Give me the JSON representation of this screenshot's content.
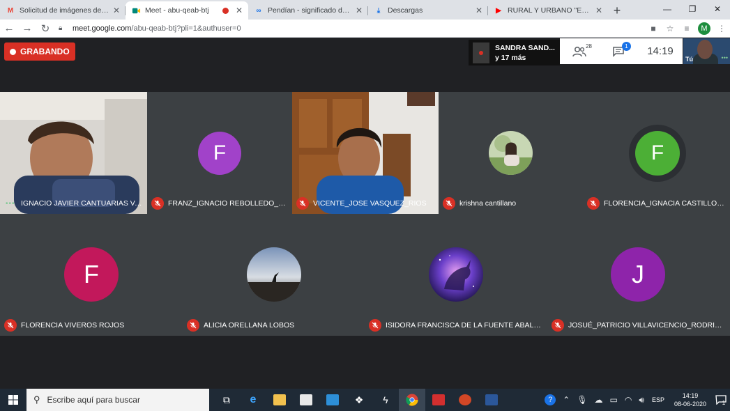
{
  "browser": {
    "tabs": [
      {
        "label": "Solicitud de imágenes de clase",
        "favicon": "M",
        "favicon_color": "#ea4335",
        "active": false,
        "recording": false
      },
      {
        "label": "Meet - abu-qeab-btj",
        "favicon": "▸",
        "favicon_color": "#00897b",
        "active": true,
        "recording": true
      },
      {
        "label": "Pendían - significado de pendí",
        "favicon": "∞",
        "favicon_color": "#1a73e8",
        "active": false,
        "recording": false
      },
      {
        "label": "Descargas",
        "favicon": "⤓",
        "favicon_color": "#1a73e8",
        "active": false,
        "recording": false
      },
      {
        "label": "RURAL Y URBANO \"EL CAMPO",
        "favicon": "▶",
        "favicon_color": "#ff0000",
        "active": false,
        "recording": false
      }
    ],
    "url_host": "meet.google.com",
    "url_path": "/abu-qeab-btj?pli=1&authuser=0",
    "profile_initial": "M"
  },
  "meet": {
    "recording_label": "GRABANDO",
    "presenter_line1": "SANDRA SAND...",
    "presenter_line2": "y 17 más",
    "participants_count": "28",
    "chat_count": "1",
    "clock": "14:19",
    "self_label": "Tú",
    "row1": [
      {
        "name": "IGNACIO JAVIER CANTUARIAS VAL...",
        "kind": "video-boy1",
        "muted": false
      },
      {
        "name": "FRANZ_IGNACIO REBOLLEDO_CAR...",
        "kind": "letter",
        "letter": "F",
        "color": "#a142c9",
        "muted": true
      },
      {
        "name": "VICENTE_JOSE VASQUEZ_RIOS",
        "kind": "video-boy2",
        "muted": true
      },
      {
        "name": "krishna cantillano",
        "kind": "photo-girl",
        "muted": true
      },
      {
        "name": "FLORENCIA_IGNACIA CASTILLO_R...",
        "kind": "letter",
        "letter": "F",
        "color": "#4caf36",
        "muted": true
      }
    ],
    "row2": [
      {
        "name": "FLORENCIA VIVEROS ROJOS",
        "kind": "letter",
        "letter": "F",
        "color": "#c2185b",
        "muted": true
      },
      {
        "name": "ALICIA ORELLANA LOBOS",
        "kind": "photo-sky",
        "muted": true
      },
      {
        "name": "ISIDORA FRANCISCA DE LA FUENTE ABALOS",
        "kind": "photo-unicorn",
        "muted": true
      },
      {
        "name": "JOSUÉ_PATRICIO VILLAVICENCIO_RODRIGUEZ",
        "kind": "letter",
        "letter": "J",
        "color": "#8e24aa",
        "muted": true
      }
    ]
  },
  "taskbar": {
    "search_placeholder": "Escribe aquí para buscar",
    "lang": "ESP",
    "time": "14:19",
    "date": "08-06-2020",
    "notif_count": "1"
  },
  "colors": {
    "meet_bg": "#202124",
    "tile_bg": "#3c4043",
    "mute_red": "#d93025",
    "taskbar_bg": "#1f2a36"
  }
}
